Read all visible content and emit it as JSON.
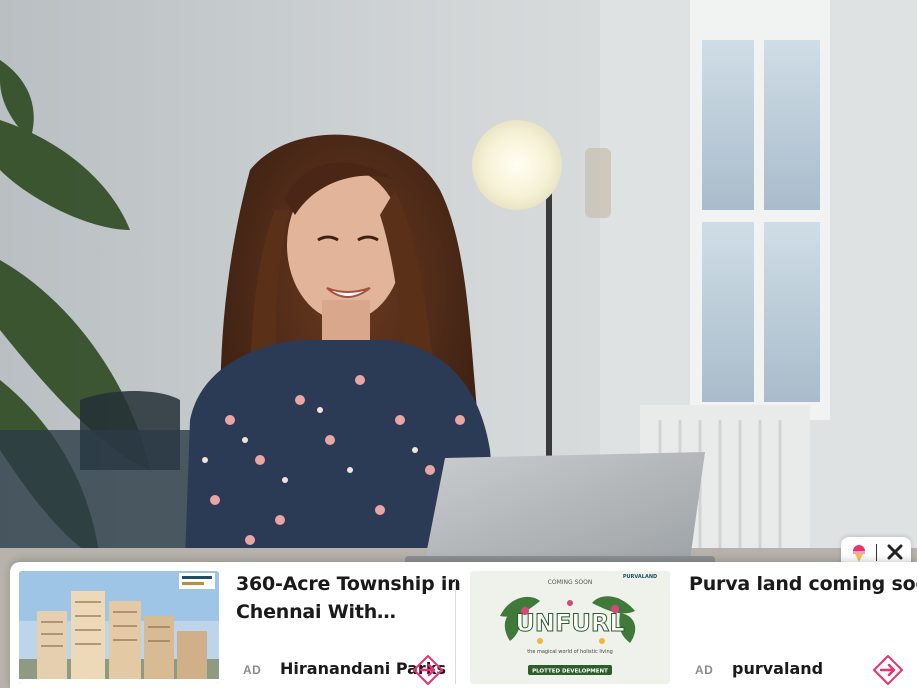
{
  "ad_strip": {
    "cards": [
      {
        "title": "360-Acre Township in\nChennai With…",
        "ad_label": "AD",
        "source": "Hiranandani Parks"
      },
      {
        "title": "Purva land coming\nsoon to Gudavanchery",
        "ad_label": "AD",
        "source": "purvaland",
        "thumb_text": {
          "top": "COMING SOON",
          "brand": "PURVALAND",
          "headline": "UNFURL",
          "tagline": "the magical world of holistic living",
          "banner": "PLOTTED DEVELOPMENT"
        }
      }
    ]
  },
  "colors": {
    "accent": "#e8336d",
    "ad_title": "#1a1a1a",
    "ad_label": "#8c8c8c"
  },
  "icons": {
    "arrow": "arrow-right-circle-icon",
    "close": "close-icon",
    "brand": "ice-cream-logo-icon"
  }
}
